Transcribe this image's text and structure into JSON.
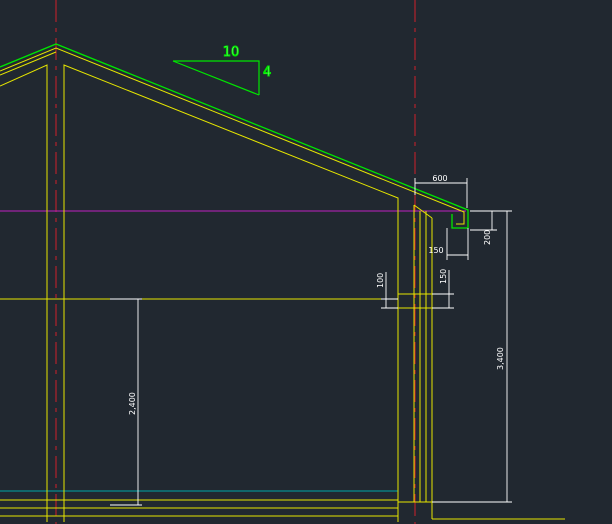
{
  "colors": {
    "background": "#212830",
    "wall": "#e6e600",
    "roof": "#00e600",
    "center_line": "#d0202a",
    "ceiling_line": "#c020c0",
    "floor_line": "#00a6a6",
    "dimension": "#ffffff"
  },
  "slope": {
    "run": "10",
    "rise": "4"
  },
  "dimensions": {
    "eave_width": "600",
    "fascia_height": "200",
    "gutter_width": "150",
    "lintel_height": "150",
    "beam_height": "100",
    "wall_height": "3,400",
    "ceiling_height": "2,400"
  }
}
